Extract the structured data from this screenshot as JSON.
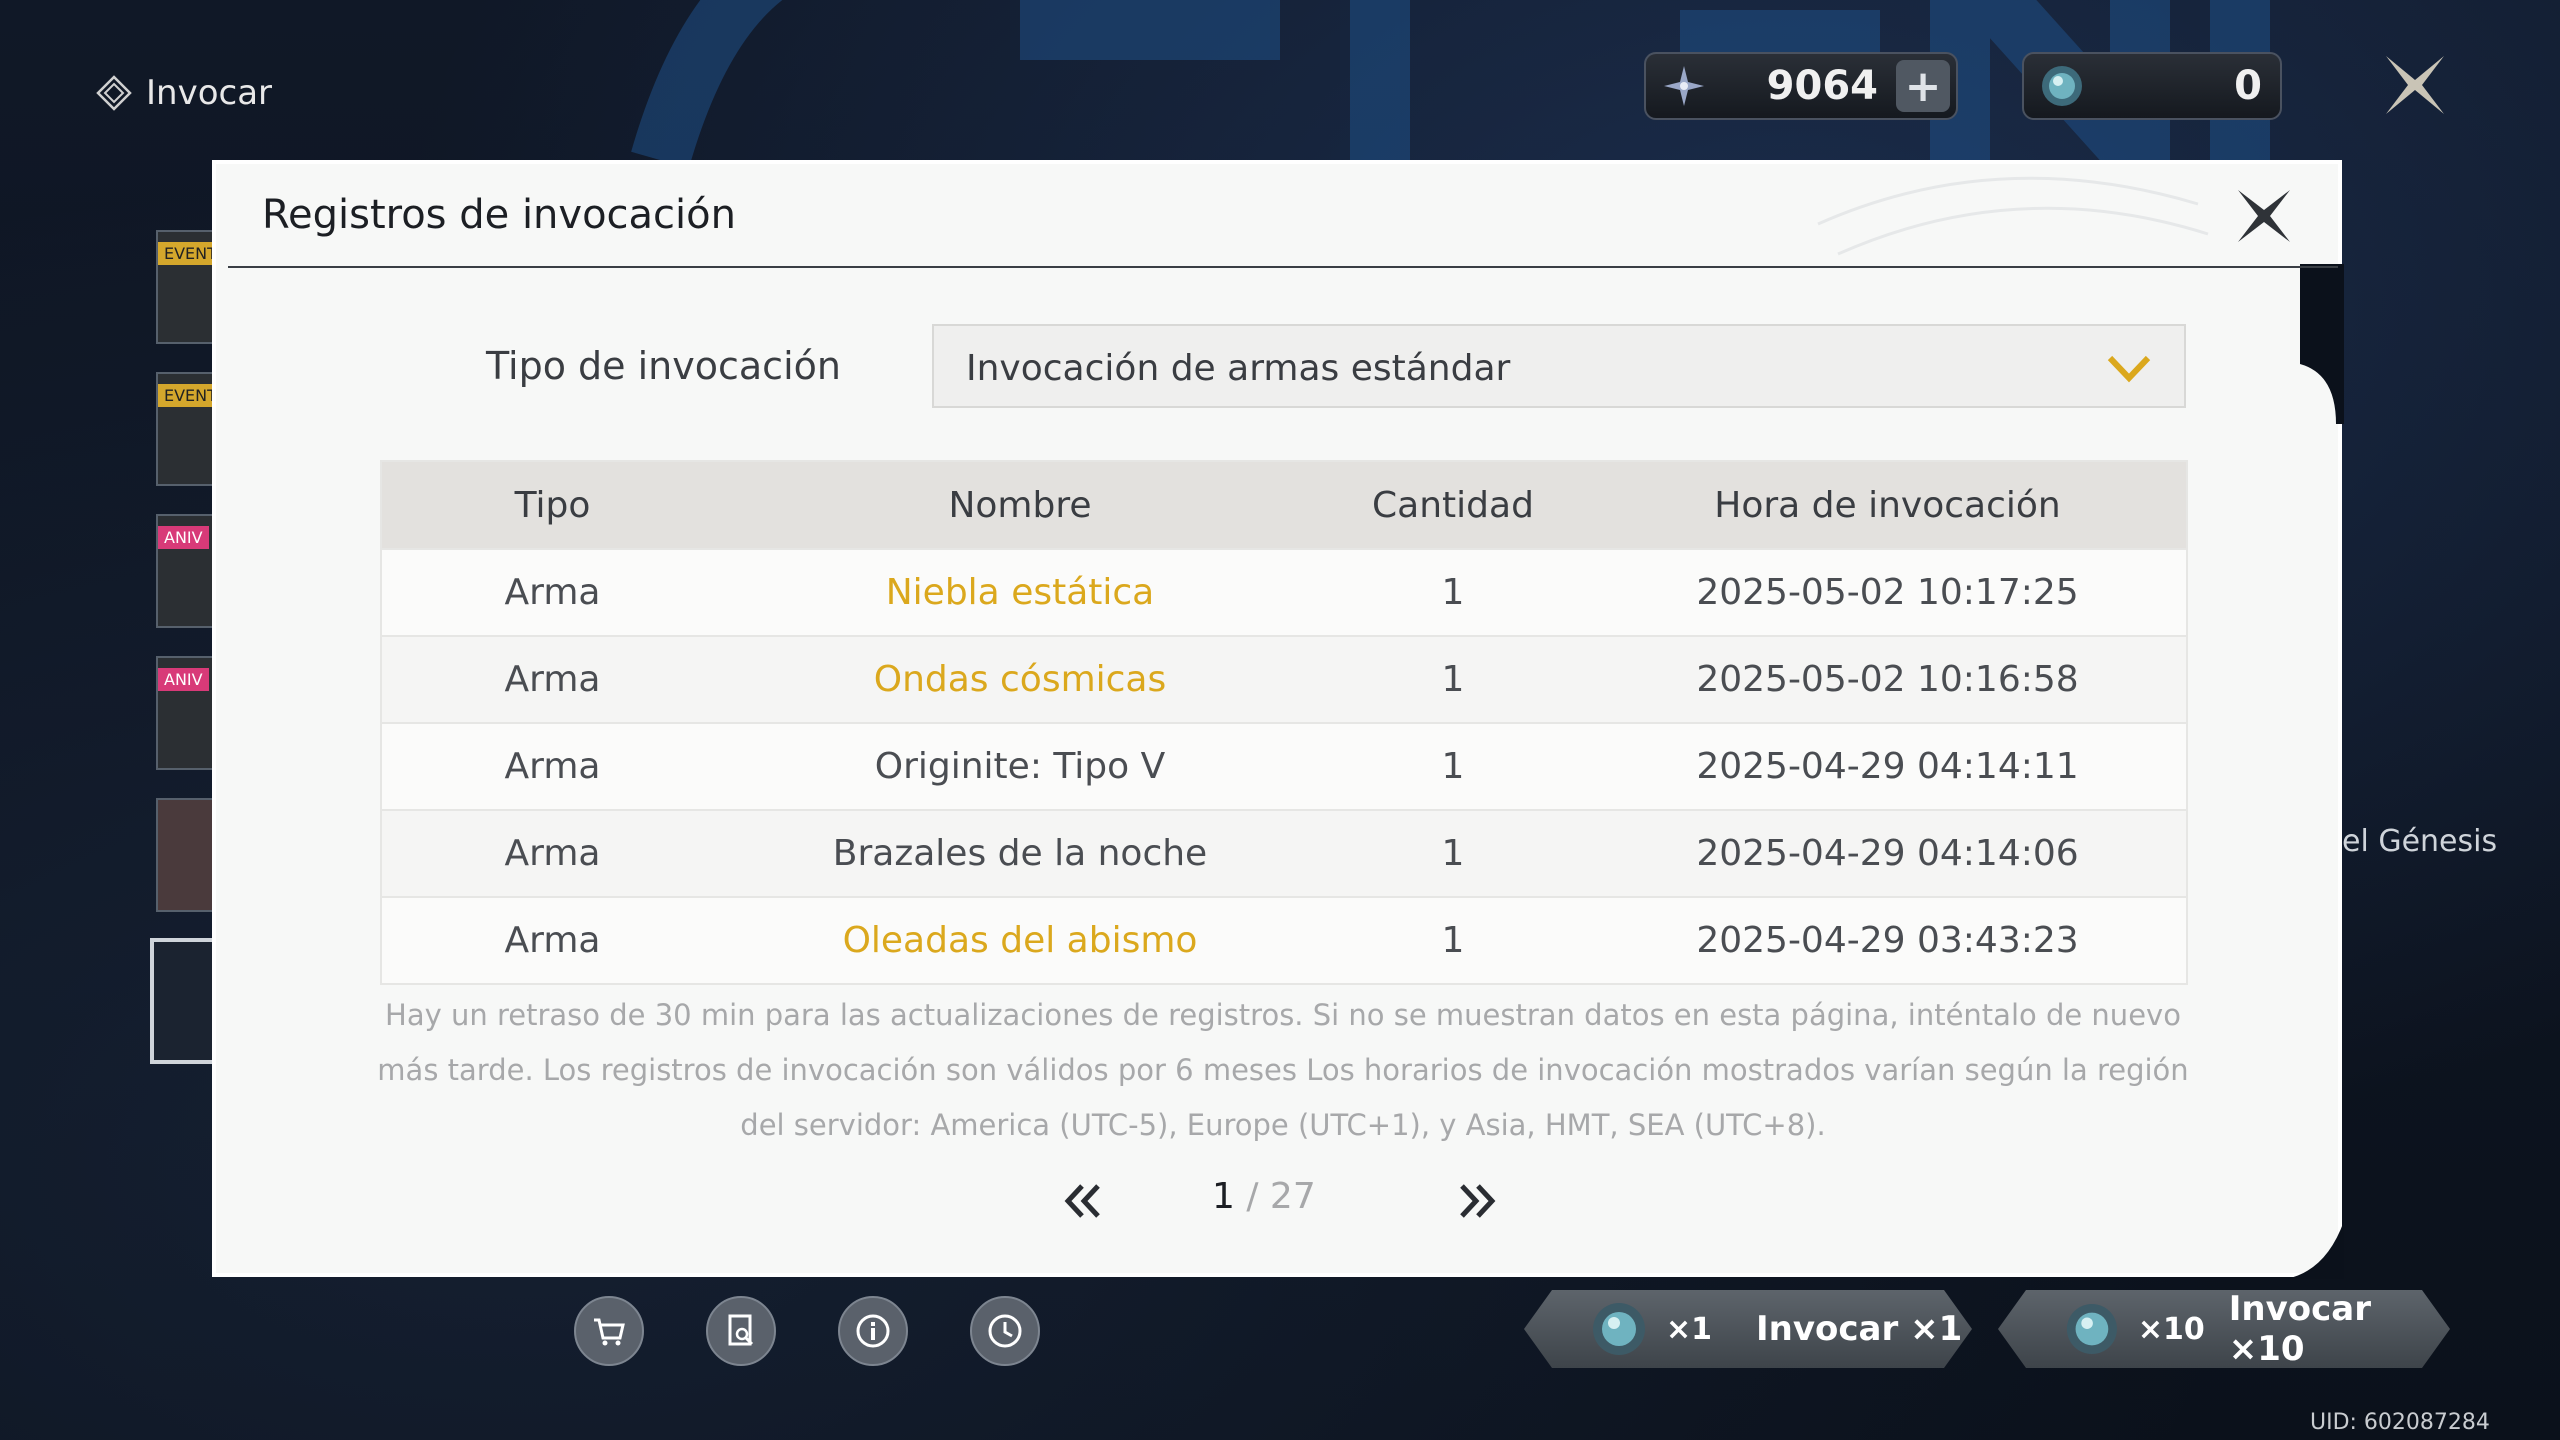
{
  "screen": {
    "title": "Invocar",
    "uid": "UID: 602087284",
    "side_tags": [
      "EVENT",
      "EVENT",
      "ANIV",
      "ANIV"
    ],
    "right_text": "el Génesis"
  },
  "currencies": [
    {
      "icon": "star-currency-icon",
      "value": "9064",
      "plus": "+"
    },
    {
      "icon": "gem-currency-icon",
      "value": "0"
    }
  ],
  "summon_buttons": [
    {
      "mult": "×1",
      "label": "Invocar ×1"
    },
    {
      "mult": "×10",
      "label": "Invocar ×10"
    }
  ],
  "modal": {
    "title": "Registros de invocación",
    "type_label": "Tipo de invocación",
    "type_value": "Invocación de armas estándar",
    "columns": [
      "Tipo",
      "Nombre",
      "Cantidad",
      "Hora de invocación"
    ],
    "rows": [
      {
        "tipo": "Arma",
        "nombre": "Niebla estática",
        "cantidad": "1",
        "hora": "2025-05-02 10:17:25",
        "highlight": true
      },
      {
        "tipo": "Arma",
        "nombre": "Ondas cósmicas",
        "cantidad": "1",
        "hora": "2025-05-02 10:16:58",
        "highlight": true
      },
      {
        "tipo": "Arma",
        "nombre": "Originite: Tipo V",
        "cantidad": "1",
        "hora": "2025-04-29 04:14:11",
        "highlight": false
      },
      {
        "tipo": "Arma",
        "nombre": "Brazales de la noche",
        "cantidad": "1",
        "hora": "2025-04-29 04:14:06",
        "highlight": false
      },
      {
        "tipo": "Arma",
        "nombre": "Oleadas del abismo",
        "cantidad": "1",
        "hora": "2025-04-29 03:43:23",
        "highlight": true
      }
    ],
    "note": "Hay un retraso de 30 min para las actualizaciones de registros. Si no se muestran datos en esta página, inténtalo de nuevo más tarde. Los registros de invocación son válidos por 6 meses Los horarios de invocación mostrados varían según la región del servidor: America (UTC-5), Europe (UTC+1), y Asia, HMT, SEA (UTC+8).",
    "page_current": "1",
    "page_total": "/ 27"
  },
  "colors": {
    "highlight": "#dba81d",
    "modal_bg": "#f7f8f7",
    "header_row": "#e3e1de"
  }
}
